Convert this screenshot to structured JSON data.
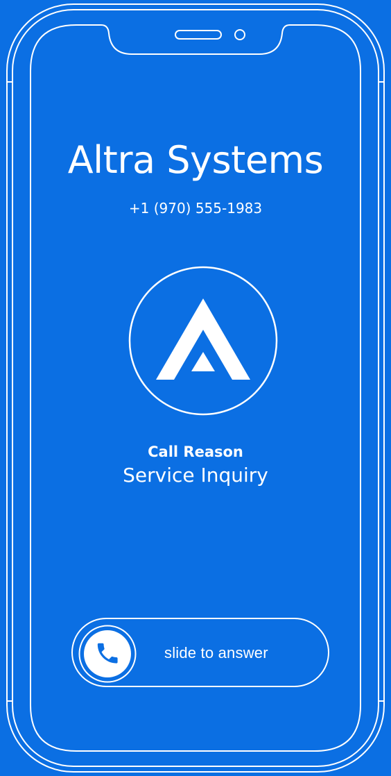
{
  "colors": {
    "background": "#0b6fe3",
    "foreground": "#ffffff"
  },
  "caller": {
    "name": "Altra Systems",
    "number": "+1 (970) 555-1983",
    "logo_icon": "triangle-logo-icon"
  },
  "call_reason": {
    "label": "Call Reason",
    "value": "Service Inquiry"
  },
  "answer_slider": {
    "label": "slide to answer",
    "icon": "phone-icon"
  }
}
